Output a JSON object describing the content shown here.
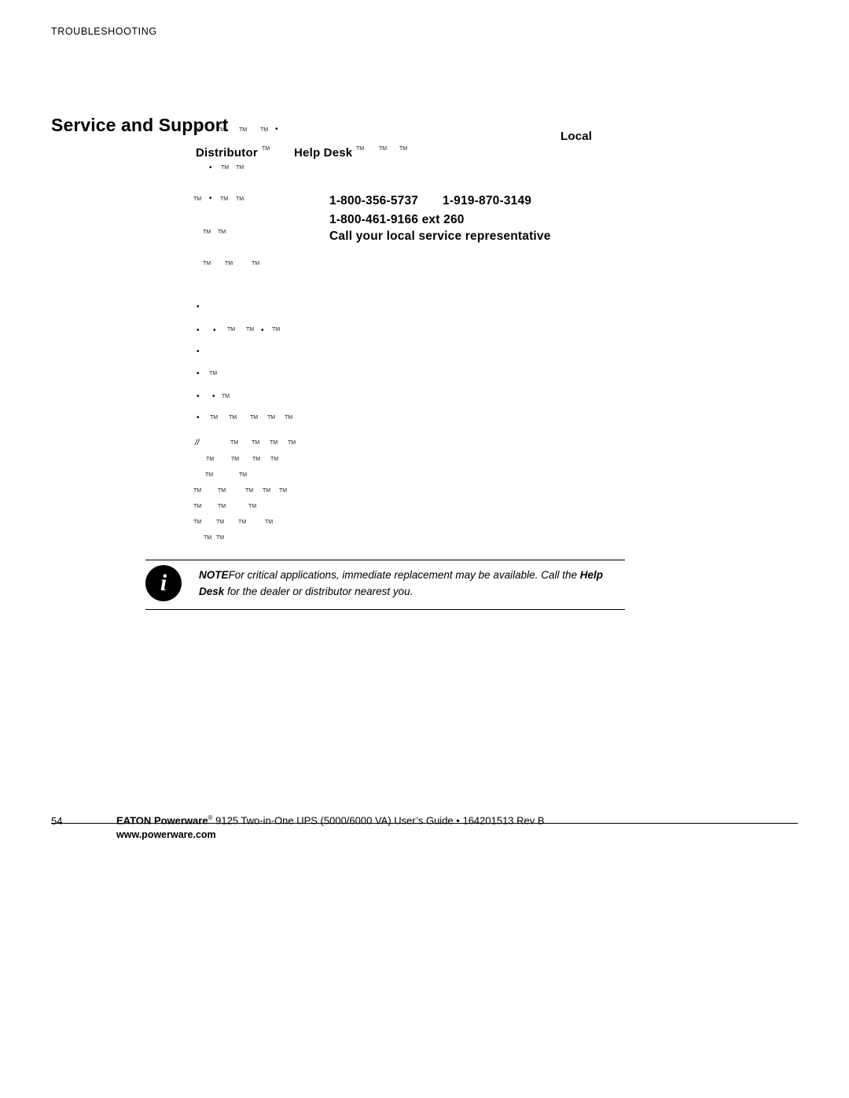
{
  "page": {
    "running_header": "TROUBLESHOOTING",
    "section_title": "Service and Support",
    "page_number": "54"
  },
  "columns": {
    "distributor_label": "Distributor",
    "help_desk_label": "Help Desk",
    "local_label": "Local"
  },
  "contacts": [
    {
      "id": "us_phone",
      "text": "1-800-356-5737"
    },
    {
      "id": "intl_phone",
      "text": "1-919-870-3149"
    },
    {
      "id": "canada_phone",
      "text": "1-800-461-9166 ext 260"
    },
    {
      "id": "local_rep",
      "text": "Call your local service representative"
    }
  ],
  "note": {
    "label": "NOTE",
    "body_1": "For critical applications, immediate replacement may be available. Call the ",
    "emphasis_1": "Help Desk",
    "body_2": " for the dealer or distributor nearest you."
  },
  "artifacts": {
    "tm": "TM",
    "dot": "•",
    "slash": "//"
  },
  "footer": {
    "brand": "EATON",
    "product_pre": "Powerware",
    "registered": "®",
    "product_post": " 9125 Two-in-One UPS (5000/6000 VA) User’s Guide",
    "separator": "•",
    "doc_id": "164201513 Rev B",
    "url": "www.powerware.com"
  }
}
